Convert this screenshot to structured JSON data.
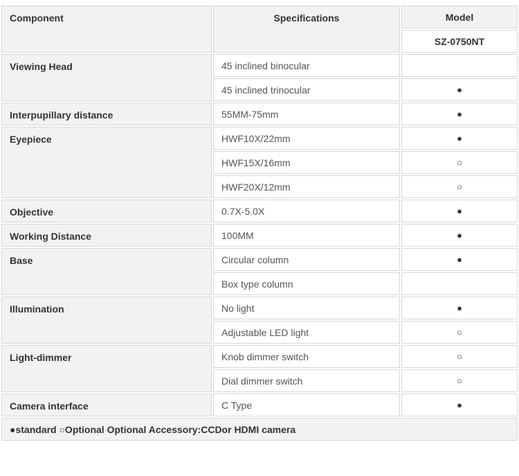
{
  "header": {
    "component": "Component",
    "specifications": "Specifications",
    "model": "Model",
    "model_name": "SZ-0750NT"
  },
  "rows": [
    {
      "component": "Viewing Head",
      "specs": [
        {
          "text": "45 inclined binocular",
          "mark": ""
        },
        {
          "text": "45 inclined trinocular",
          "mark": "●"
        }
      ]
    },
    {
      "component": "Interpupillary distance",
      "specs": [
        {
          "text": "55MM-75mm",
          "mark": "●"
        }
      ]
    },
    {
      "component": "Eyepiece",
      "specs": [
        {
          "text": "HWF10X/22mm",
          "mark": "●"
        },
        {
          "text": "HWF15X/16mm",
          "mark": "○"
        },
        {
          "text": "HWF20X/12mm",
          "mark": "○"
        }
      ]
    },
    {
      "component": "Objective",
      "specs": [
        {
          "text": "0.7X-5.0X",
          "mark": "●"
        }
      ]
    },
    {
      "component": "Working Distance",
      "specs": [
        {
          "text": "100MM",
          "mark": "●"
        }
      ]
    },
    {
      "component": "Base",
      "specs": [
        {
          "text": "Circular column",
          "mark": "●"
        },
        {
          "text": "Box type column",
          "mark": ""
        }
      ]
    },
    {
      "component": "Illumination",
      "specs": [
        {
          "text": "No light",
          "mark": "●"
        },
        {
          "text": "Adjustable LED light",
          "mark": "○"
        }
      ]
    },
    {
      "component": "Light-dimmer",
      "specs": [
        {
          "text": "Knob dimmer switch",
          "mark": "○"
        },
        {
          "text": "Dial dimmer switch",
          "mark": "○"
        }
      ]
    },
    {
      "component": "Camera interface",
      "specs": [
        {
          "text": "C Type",
          "mark": "●"
        }
      ]
    }
  ],
  "footer": "●standard ○Optional Optional Accessory:CCDor HDMI camera"
}
